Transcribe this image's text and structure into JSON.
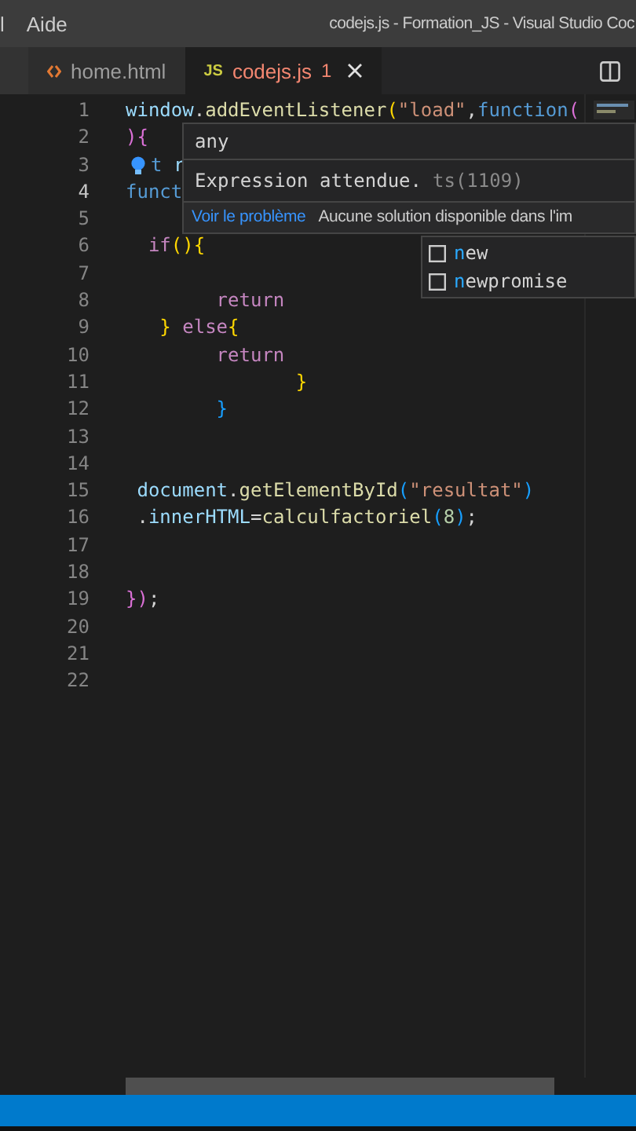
{
  "menu": [
    {
      "label": "l"
    },
    {
      "label": "Aide"
    }
  ],
  "window": {
    "title": "codejs.js - Formation_JS - Visual Studio Coc"
  },
  "tabs": [
    {
      "label": "home.html",
      "kind": "html",
      "selected": false
    },
    {
      "label": "codejs.js",
      "kind": "js",
      "type_label": "JS",
      "problems": "1",
      "selected": true
    }
  ],
  "lines": [
    {
      "number": "1",
      "current": false,
      "bulb": false,
      "tokens": [
        {
          "text": "window",
          "kind": "var"
        },
        {
          "text": ".",
          "kind": "p"
        },
        {
          "text": "addEventListener",
          "kind": "fn"
        },
        {
          "text": "(",
          "kind": "b1"
        },
        {
          "text": "\"load\"",
          "kind": "str"
        },
        {
          "text": ",",
          "kind": "p"
        },
        {
          "text": "function",
          "kind": "kw"
        },
        {
          "text": "(",
          "kind": "b2"
        }
      ]
    },
    {
      "number": "2",
      "current": false,
      "bulb": false,
      "tokens": [
        {
          "text": ")",
          "kind": "b2"
        },
        {
          "text": "{",
          "kind": "b2"
        }
      ]
    },
    {
      "number": "3",
      "current": false,
      "bulb": true,
      "tokens": [
        {
          "text": "t",
          "kind": "kw"
        },
        {
          "text": " r",
          "kind": "var"
        }
      ]
    },
    {
      "number": "4",
      "current": true,
      "bulb": false,
      "tokens": [
        {
          "text": "funct",
          "kind": "kw"
        }
      ]
    },
    {
      "number": "5",
      "current": false,
      "bulb": false
    },
    {
      "number": "6",
      "current": false,
      "bulb": false,
      "tokens": [
        {
          "text": "  if",
          "kind": "ctrl"
        },
        {
          "text": "(",
          "kind": "b1"
        },
        {
          "text": ")",
          "kind": "b1"
        },
        {
          "text": "{",
          "kind": "b1"
        }
      ]
    },
    {
      "number": "7",
      "current": false,
      "bulb": false
    },
    {
      "number": "8",
      "current": false,
      "bulb": false,
      "tokens": [
        {
          "text": "        return",
          "kind": "ctrl"
        }
      ]
    },
    {
      "number": "9",
      "current": false,
      "bulb": false,
      "tokens": [
        {
          "text": "   }",
          "kind": "b1"
        },
        {
          "text": " else",
          "kind": "ctrl"
        },
        {
          "text": "{",
          "kind": "b1"
        }
      ]
    },
    {
      "number": "10",
      "current": false,
      "bulb": false,
      "tokens": [
        {
          "text": "        return",
          "kind": "ctrl"
        }
      ]
    },
    {
      "number": "11",
      "current": false,
      "bulb": false,
      "tokens": [
        {
          "text": "               }",
          "kind": "b1"
        }
      ]
    },
    {
      "number": "12",
      "current": false,
      "bulb": false,
      "tokens": [
        {
          "text": "        }",
          "kind": "b3"
        }
      ]
    },
    {
      "number": "13",
      "current": false,
      "bulb": false
    },
    {
      "number": "14",
      "current": false,
      "bulb": false
    },
    {
      "number": "15",
      "current": false,
      "bulb": false,
      "tokens": [
        {
          "text": " document",
          "kind": "var"
        },
        {
          "text": ".",
          "kind": "p"
        },
        {
          "text": "getElementById",
          "kind": "fn"
        },
        {
          "text": "(",
          "kind": "b3"
        },
        {
          "text": "\"resultat\"",
          "kind": "str"
        },
        {
          "text": ")",
          "kind": "b3"
        }
      ]
    },
    {
      "number": "16",
      "current": false,
      "bulb": false,
      "tokens": [
        {
          "text": " .",
          "kind": "p"
        },
        {
          "text": "innerHTML",
          "kind": "var"
        },
        {
          "text": "=",
          "kind": "p"
        },
        {
          "text": "calculfactoriel",
          "kind": "fn"
        },
        {
          "text": "(",
          "kind": "b3"
        },
        {
          "text": "8",
          "kind": "num"
        },
        {
          "text": ")",
          "kind": "b3"
        },
        {
          "text": ";",
          "kind": "p"
        }
      ]
    },
    {
      "number": "17",
      "current": false,
      "bulb": false
    },
    {
      "number": "18",
      "current": false,
      "bulb": false
    },
    {
      "number": "19",
      "current": false,
      "bulb": false,
      "tokens": [
        {
          "text": "})",
          "kind": "b2"
        },
        {
          "text": ";",
          "kind": "p"
        }
      ]
    },
    {
      "number": "20",
      "current": false,
      "bulb": false
    },
    {
      "number": "21",
      "current": false,
      "bulb": false
    },
    {
      "number": "22",
      "current": false,
      "bulb": false
    }
  ],
  "hover": {
    "type_text": "any",
    "message": "Expression attendue.",
    "code": "ts(1109)",
    "actions": [
      {
        "label": "Voir le problème",
        "kind": "link"
      },
      {
        "label": "Aucune solution disponible dans l'im",
        "kind": "note"
      }
    ]
  },
  "suggestions": [
    {
      "match": "n",
      "rest": "ew",
      "selected": false
    },
    {
      "match": "n",
      "rest": "ewpromise",
      "selected": false
    }
  ]
}
